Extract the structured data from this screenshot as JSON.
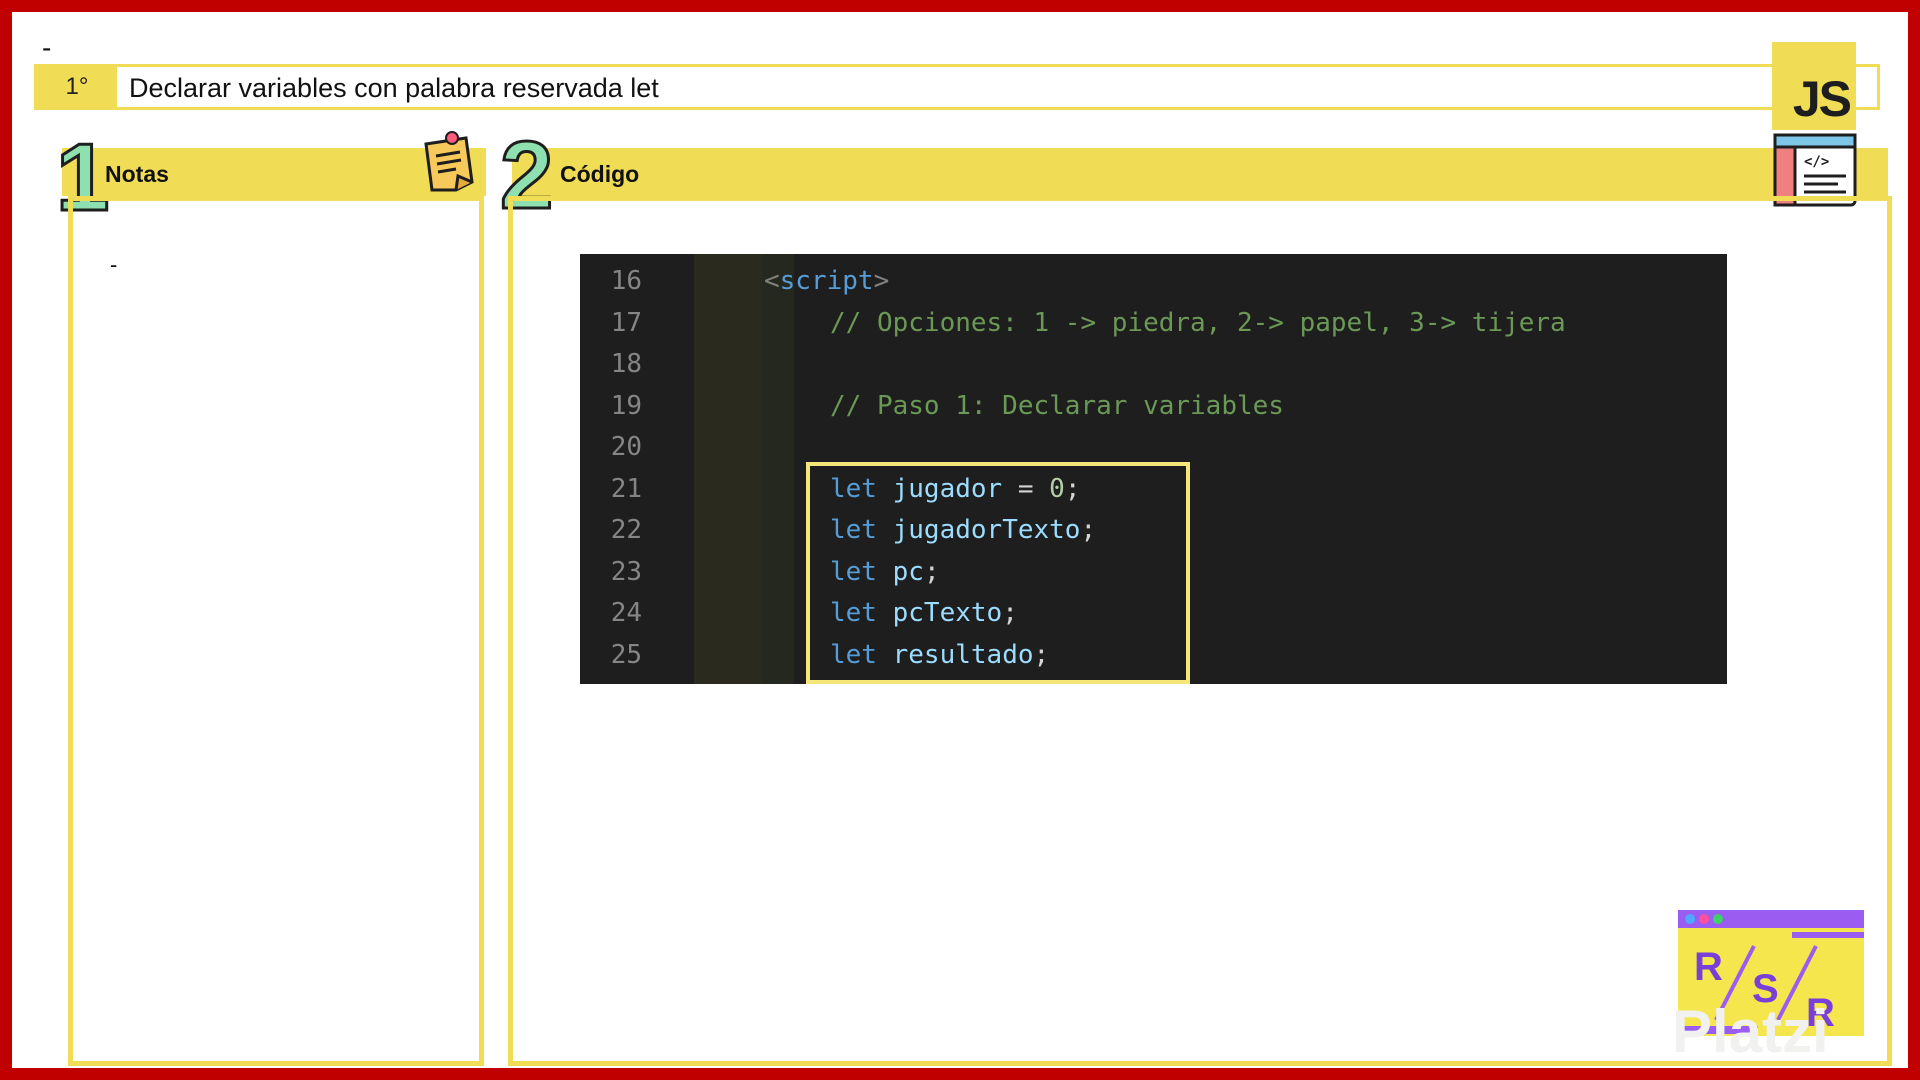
{
  "header": {
    "top_dash": "-",
    "step": "1°",
    "title": "Declarar variables con palabra reservada let",
    "logo_text": "JS"
  },
  "notes": {
    "number": "1",
    "title": "Notas",
    "content": "-",
    "icon": "sticky-note-icon"
  },
  "code_section": {
    "number": "2",
    "title": "Código",
    "icon": "code-window-icon"
  },
  "code": {
    "lines": [
      {
        "n": "16",
        "segments": [
          [
            "bracket",
            "<"
          ],
          [
            "tag",
            "script"
          ],
          [
            "bracket",
            ">"
          ]
        ],
        "indent": 1
      },
      {
        "n": "17",
        "segments": [
          [
            "comment",
            "// Opciones: 1 -> piedra, 2-> papel, 3-> tijera"
          ]
        ],
        "indent": 2
      },
      {
        "n": "18",
        "segments": [],
        "indent": 2
      },
      {
        "n": "19",
        "segments": [
          [
            "comment",
            "// Paso 1: Declarar variables"
          ]
        ],
        "indent": 2
      },
      {
        "n": "20",
        "segments": [],
        "indent": 2
      },
      {
        "n": "21",
        "segments": [
          [
            "kw",
            "let"
          ],
          [
            "plain",
            " "
          ],
          [
            "var",
            "jugador"
          ],
          [
            "plain",
            " = "
          ],
          [
            "num",
            "0"
          ],
          [
            "plain",
            ";"
          ]
        ],
        "indent": 2
      },
      {
        "n": "22",
        "segments": [
          [
            "kw",
            "let"
          ],
          [
            "plain",
            " "
          ],
          [
            "var",
            "jugadorTexto"
          ],
          [
            "plain",
            ";"
          ]
        ],
        "indent": 2
      },
      {
        "n": "23",
        "segments": [
          [
            "kw",
            "let"
          ],
          [
            "plain",
            " "
          ],
          [
            "var",
            "pc"
          ],
          [
            "plain",
            ";"
          ]
        ],
        "indent": 2
      },
      {
        "n": "24",
        "segments": [
          [
            "kw",
            "let"
          ],
          [
            "plain",
            " "
          ],
          [
            "var",
            "pcTexto"
          ],
          [
            "plain",
            ";"
          ]
        ],
        "indent": 2
      },
      {
        "n": "25",
        "segments": [
          [
            "kw",
            "let"
          ],
          [
            "plain",
            " "
          ],
          [
            "var",
            "resultado"
          ],
          [
            "plain",
            ";"
          ]
        ],
        "indent": 2
      }
    ]
  },
  "badge": {
    "letters": [
      "R",
      "S",
      "R"
    ],
    "dots": [
      "#4ea8ff",
      "#ff4fa0",
      "#3ed06a"
    ]
  },
  "watermark": "Platzi",
  "colors": {
    "frame": "#c00000",
    "accent": "#f0dc55",
    "code_bg": "#1e1e1e"
  }
}
